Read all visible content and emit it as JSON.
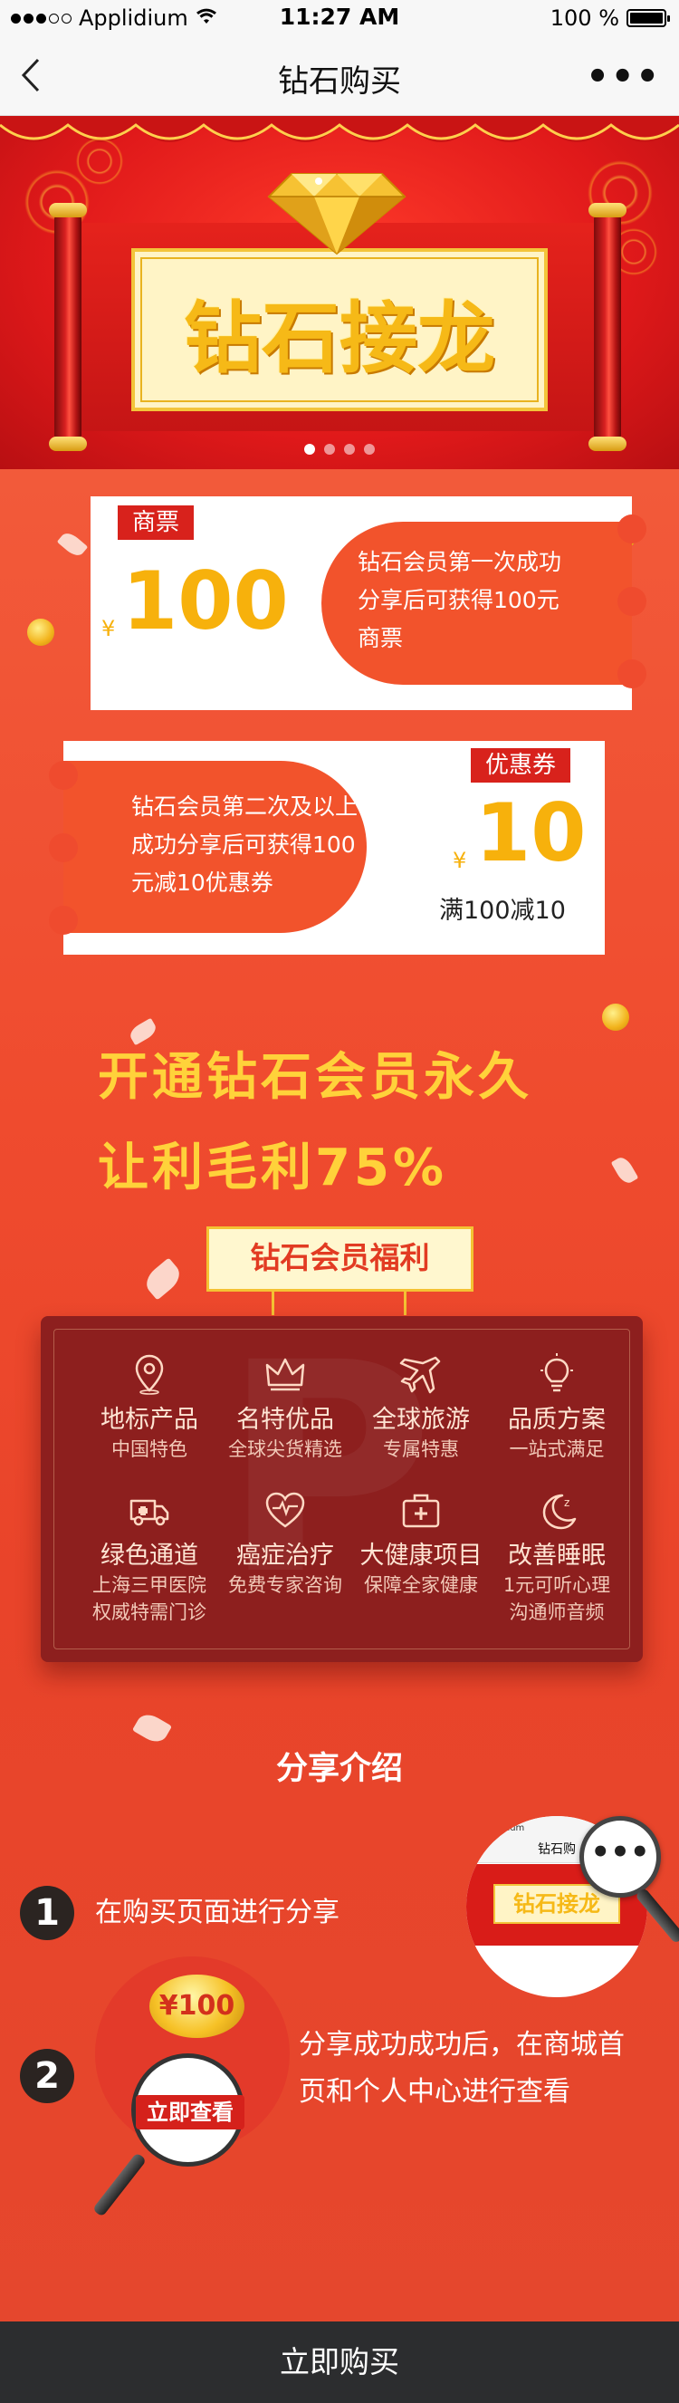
{
  "status_bar": {
    "carrier": "Applidium",
    "time": "11:27 AM",
    "battery": "100 %"
  },
  "nav": {
    "title": "钻石购买",
    "back_icon": "chevron-left-icon",
    "more_icon": "more-dots-icon"
  },
  "banner": {
    "title": "钻石接龙",
    "pager_count": 4,
    "pager_active": 0
  },
  "coupons": [
    {
      "tag": "商票",
      "currency": "¥",
      "amount": "100",
      "lines": [
        "钻石会员第一次成功",
        "分享后可获得100元",
        "商票"
      ]
    },
    {
      "tag": "优惠券",
      "currency": "¥",
      "amount": "10",
      "subtitle": "满100减10",
      "lines": [
        "钻石会员第二次及以上",
        "成功分享后可获得100",
        "元减10优惠券"
      ]
    }
  ],
  "headline": {
    "line1": "开通钻石会员永久",
    "line2": "让利毛利75%"
  },
  "welfare": {
    "badge": "钻石会员福利",
    "items": [
      {
        "icon": "location-pin-icon",
        "title": "地标产品",
        "desc": "中国特色"
      },
      {
        "icon": "crown-icon",
        "title": "名特优品",
        "desc": "全球尖货精选"
      },
      {
        "icon": "airplane-icon",
        "title": "全球旅游",
        "desc": "专属特惠"
      },
      {
        "icon": "lightbulb-icon",
        "title": "品质方案",
        "desc": "一站式满足"
      },
      {
        "icon": "ambulance-icon",
        "title": "绿色通道",
        "desc": "上海三甲医院",
        "desc2": "权威特需门诊"
      },
      {
        "icon": "heart-pulse-icon",
        "title": "癌症治疗",
        "desc": "免费专家咨询"
      },
      {
        "icon": "first-aid-kit-icon",
        "title": "大健康项目",
        "desc": "保障全家健康"
      },
      {
        "icon": "moon-sleep-icon",
        "title": "改善睡眠",
        "desc": "1元可听心理",
        "desc2": "沟通师音频"
      }
    ]
  },
  "share": {
    "title": "分享介绍",
    "steps": [
      {
        "num": "1",
        "text": "在购买页面进行分享"
      },
      {
        "num": "2",
        "text_line1": "分享成功成功后，在商城首",
        "text_line2": "页和个人中心进行查看"
      }
    ],
    "preview": {
      "carrier": "Applidium",
      "title": "钻石购",
      "banner": "钻石接龙",
      "more": "•••"
    },
    "step2_coin": "¥100",
    "view_button": "立即查看"
  },
  "buy_button": "立即购买",
  "colors": {
    "accent_red": "#d8221c",
    "gold": "#f7b10c",
    "orange_panel": "#f2532c",
    "bottom_bar": "#2c2d2f"
  }
}
